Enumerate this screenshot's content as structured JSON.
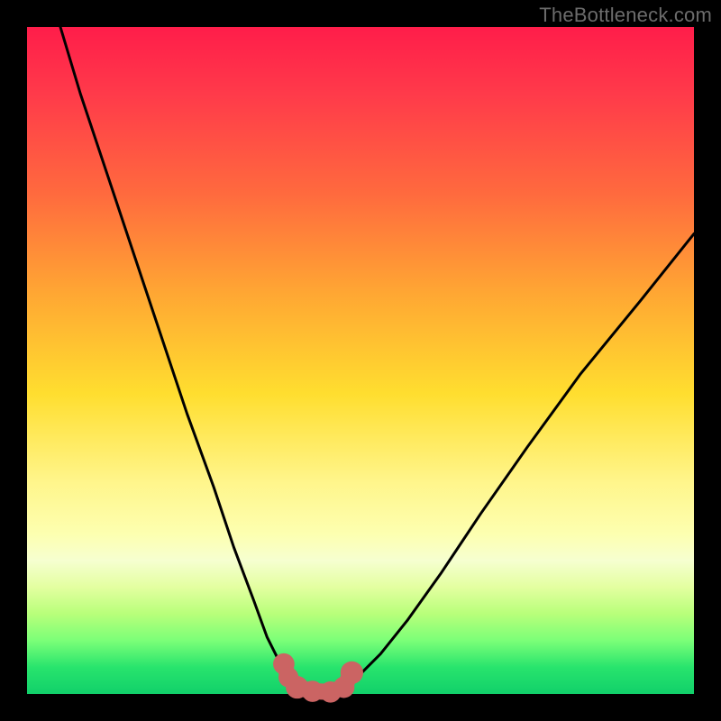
{
  "site": {
    "watermark": "TheBottleneck.com"
  },
  "palette": {
    "curve_stroke": "#000000",
    "blob_fill": "#cb6463",
    "background": "#000000"
  },
  "chart_data": {
    "type": "line",
    "title": "",
    "xlabel": "",
    "ylabel": "",
    "xlim": [
      0,
      1
    ],
    "ylim": [
      0,
      1
    ],
    "grid": false,
    "legend": false,
    "annotations": [],
    "series": [
      {
        "name": "left-branch",
        "x": [
          0.05,
          0.08,
          0.12,
          0.16,
          0.2,
          0.24,
          0.28,
          0.31,
          0.34,
          0.36,
          0.38,
          0.395
        ],
        "y": [
          1.0,
          0.9,
          0.78,
          0.66,
          0.54,
          0.42,
          0.31,
          0.22,
          0.14,
          0.085,
          0.045,
          0.02
        ]
      },
      {
        "name": "valley-floor",
        "x": [
          0.395,
          0.41,
          0.43,
          0.45,
          0.47,
          0.485
        ],
        "y": [
          0.02,
          0.005,
          0.0,
          0.0,
          0.003,
          0.015
        ]
      },
      {
        "name": "right-branch",
        "x": [
          0.485,
          0.5,
          0.53,
          0.57,
          0.62,
          0.68,
          0.75,
          0.83,
          0.92,
          1.0
        ],
        "y": [
          0.015,
          0.03,
          0.06,
          0.11,
          0.18,
          0.27,
          0.37,
          0.48,
          0.59,
          0.69
        ]
      }
    ],
    "blobs": [
      {
        "cx": 0.385,
        "cy": 0.045,
        "r": 0.016
      },
      {
        "cx": 0.392,
        "cy": 0.025,
        "r": 0.015
      },
      {
        "cx": 0.405,
        "cy": 0.01,
        "r": 0.017
      },
      {
        "cx": 0.428,
        "cy": 0.004,
        "r": 0.016
      },
      {
        "cx": 0.455,
        "cy": 0.003,
        "r": 0.016
      },
      {
        "cx": 0.475,
        "cy": 0.01,
        "r": 0.016
      },
      {
        "cx": 0.487,
        "cy": 0.032,
        "r": 0.017
      }
    ],
    "blob_connector": {
      "x": [
        0.385,
        0.392,
        0.405,
        0.428,
        0.455,
        0.475,
        0.487
      ],
      "y": [
        0.045,
        0.025,
        0.01,
        0.004,
        0.003,
        0.01,
        0.032
      ]
    }
  }
}
